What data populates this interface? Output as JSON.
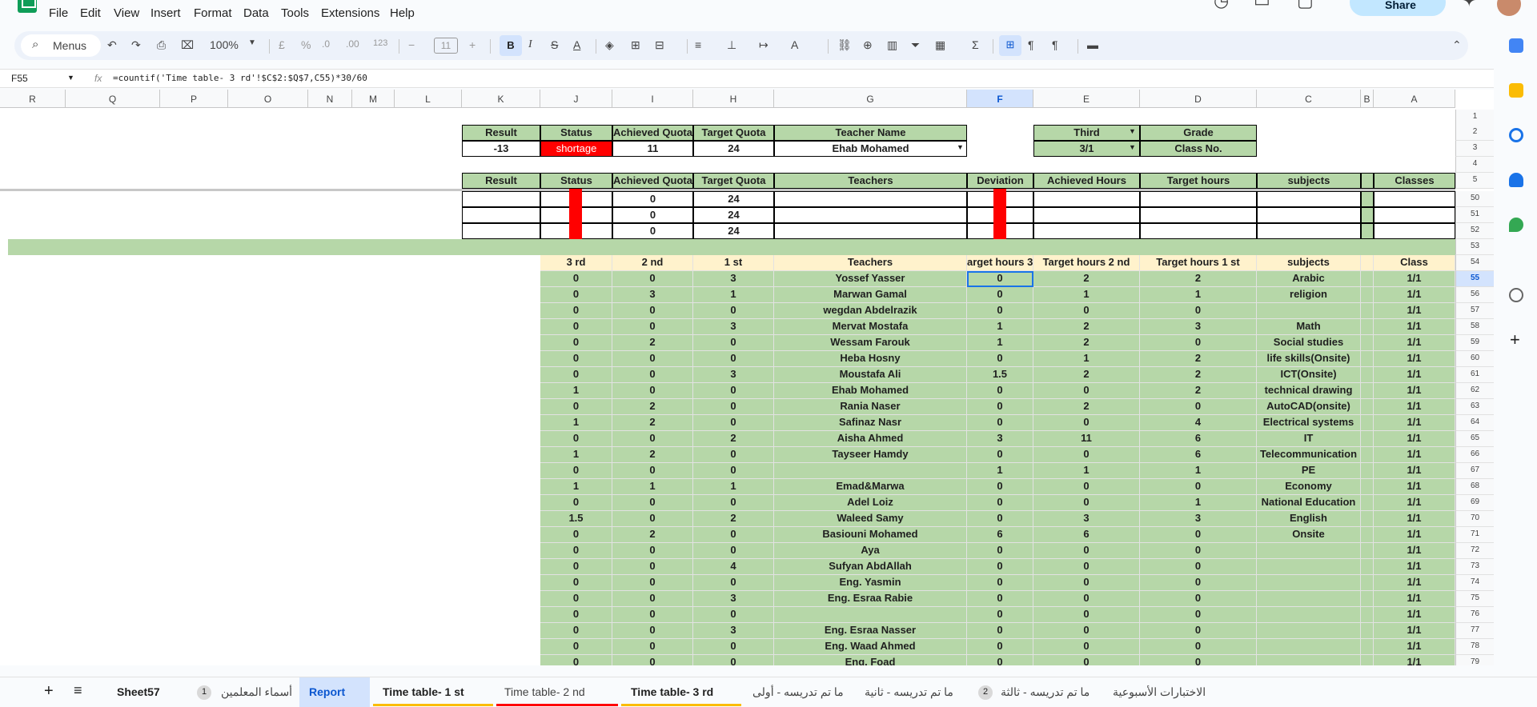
{
  "app": {
    "menus": [
      "File",
      "Edit",
      "View",
      "Insert",
      "Format",
      "Data",
      "Tools",
      "Extensions",
      "Help"
    ],
    "share_label": "Share"
  },
  "toolbar": {
    "search_label": "Menus",
    "zoom": "100%",
    "currency": "£",
    "percent": "%",
    "dec_minus": ".0",
    "dec_plus": ".00",
    "format_num": "123",
    "font_size": "11",
    "bold": "B",
    "italic": "I"
  },
  "formula_bar": {
    "cell_ref": "F55",
    "fx": "fx",
    "formula": "=countif('Time table- 3 rd'!$C$2:$Q$7,C55)*30/60"
  },
  "columns": [
    "R",
    "Q",
    "P",
    "O",
    "N",
    "M",
    "L",
    "K",
    "J",
    "I",
    "H",
    "G",
    "F",
    "E",
    "D",
    "C",
    "B",
    "A"
  ],
  "top_rows": [
    "1",
    "2",
    "3",
    "4",
    "5",
    "50",
    "51",
    "52",
    "53",
    "54"
  ],
  "summary": {
    "h_result": "Result",
    "h_status": "Status",
    "h_achieved": "Achieved Quota",
    "h_target": "Target Quota",
    "h_teacher": "Teacher Name",
    "h_third": "Third",
    "h_grade": "Grade",
    "result": "-13",
    "status": "shortage",
    "achieved": "11",
    "target": "24",
    "teacher": "Ehab Mohamed",
    "class_val": "3/1",
    "class_no": "Class No."
  },
  "header5": {
    "result": "Result",
    "status": "Status",
    "achieved": "Achieved Quota",
    "target": "Target Quota",
    "teachers": "Teachers",
    "deviation": "Deviation",
    "ach_hours": "Achieved  Hours",
    "tgt_hours": "Target  hours",
    "subjects": "subjects",
    "classes": "Classes"
  },
  "mid_rows": [
    {
      "achieved": "0",
      "target": "24"
    },
    {
      "achieved": "0",
      "target": "24"
    },
    {
      "achieved": "0",
      "target": "24"
    }
  ],
  "header54": {
    "third": "3 rd",
    "second": "2 nd",
    "first": "1 st",
    "teachers": "Teachers",
    "h3": "arget hours  3r",
    "h2": "Target hours 2 nd",
    "h1": "Target hours 1 st",
    "subjects": "subjects",
    "class": "Class"
  },
  "rows": [
    [
      "55",
      "0",
      "0",
      "3",
      "Yossef Yasser",
      "0",
      "2",
      "2",
      "Arabic",
      "1/1"
    ],
    [
      "56",
      "0",
      "3",
      "1",
      "Marwan Gamal",
      "0",
      "1",
      "1",
      "religion",
      "1/1"
    ],
    [
      "57",
      "0",
      "0",
      "0",
      "wegdan Abdelrazik",
      "0",
      "0",
      "0",
      "",
      "1/1"
    ],
    [
      "58",
      "0",
      "0",
      "3",
      "Mervat Mostafa",
      "1",
      "2",
      "3",
      "Math",
      "1/1"
    ],
    [
      "59",
      "0",
      "2",
      "0",
      "Wessam Farouk",
      "1",
      "2",
      "0",
      "Social studies",
      "1/1"
    ],
    [
      "60",
      "0",
      "0",
      "0",
      "Heba Hosny",
      "0",
      "1",
      "2",
      "life skills(Onsite)",
      "1/1"
    ],
    [
      "61",
      "0",
      "0",
      "3",
      "Moustafa Ali",
      "1.5",
      "2",
      "2",
      "ICT(Onsite)",
      "1/1"
    ],
    [
      "62",
      "1",
      "0",
      "0",
      "Ehab Mohamed",
      "0",
      "0",
      "2",
      "technical drawing",
      "1/1"
    ],
    [
      "63",
      "0",
      "2",
      "0",
      "Rania Naser",
      "0",
      "2",
      "0",
      "AutoCAD(onsite)",
      "1/1"
    ],
    [
      "64",
      "1",
      "2",
      "0",
      "Safinaz Nasr",
      "0",
      "0",
      "4",
      "Electrical systems",
      "1/1"
    ],
    [
      "65",
      "0",
      "0",
      "2",
      "Aisha Ahmed",
      "3",
      "11",
      "6",
      "IT",
      "1/1"
    ],
    [
      "66",
      "1",
      "2",
      "0",
      "Tayseer Hamdy",
      "0",
      "0",
      "6",
      "Telecommunication",
      "1/1"
    ],
    [
      "67",
      "0",
      "0",
      "0",
      "",
      "1",
      "1",
      "1",
      "PE",
      "1/1"
    ],
    [
      "68",
      "1",
      "1",
      "1",
      "Emad&Marwa",
      "0",
      "0",
      "0",
      "Economy",
      "1/1"
    ],
    [
      "69",
      "0",
      "0",
      "0",
      "Adel Loiz",
      "0",
      "0",
      "1",
      "National Education",
      "1/1"
    ],
    [
      "70",
      "1.5",
      "0",
      "2",
      "Waleed Samy",
      "0",
      "3",
      "3",
      "English",
      "1/1"
    ],
    [
      "71",
      "0",
      "2",
      "0",
      "Basiouni Mohamed",
      "6",
      "6",
      "0",
      "Onsite",
      "1/1"
    ],
    [
      "72",
      "0",
      "0",
      "0",
      "Aya",
      "0",
      "0",
      "0",
      "",
      "1/1"
    ],
    [
      "73",
      "0",
      "0",
      "4",
      "Sufyan AbdAllah",
      "0",
      "0",
      "0",
      "",
      "1/1"
    ],
    [
      "74",
      "0",
      "0",
      "0",
      "Eng. Yasmin",
      "0",
      "0",
      "0",
      "",
      "1/1"
    ],
    [
      "75",
      "0",
      "0",
      "3",
      "Eng. Esraa Rabie",
      "0",
      "0",
      "0",
      "",
      "1/1"
    ],
    [
      "76",
      "0",
      "0",
      "0",
      "",
      "0",
      "0",
      "0",
      "",
      "1/1"
    ],
    [
      "77",
      "0",
      "0",
      "3",
      "Eng. Esraa Nasser",
      "0",
      "0",
      "0",
      "",
      "1/1"
    ],
    [
      "78",
      "0",
      "0",
      "0",
      "Eng. Waad Ahmed",
      "0",
      "0",
      "0",
      "",
      "1/1"
    ],
    [
      "79",
      "0",
      "0",
      "0",
      "Eng. Foad",
      "0",
      "0",
      "0",
      "",
      "1/1"
    ]
  ],
  "tabs": [
    "Sheet57",
    "1",
    "أسماء المعلمين",
    "Report",
    "Time table- 1 st",
    "Time table- 2 nd",
    "Time table- 3 rd",
    "ما تم تدريسه - أولى",
    "ما تم تدريسه - ثانية",
    "2",
    "ما تم تدريسه - ثالثة",
    "الاختبارات الأسبوعية"
  ],
  "colors": {
    "green": "#b6d7a8",
    "yellow": "#fff2cc",
    "red": "#ff0000",
    "selection": "#1a73e8"
  }
}
